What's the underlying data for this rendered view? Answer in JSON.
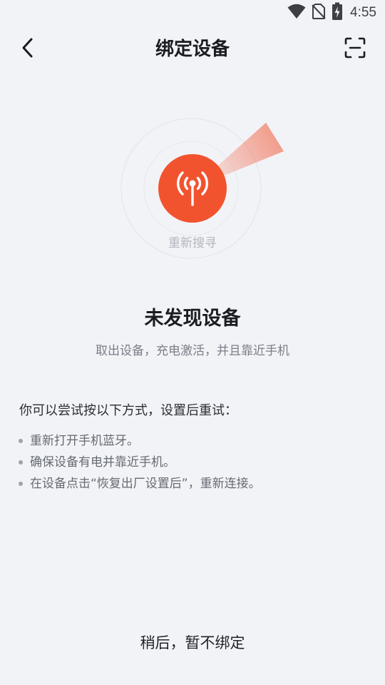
{
  "status_bar": {
    "time": "4:55",
    "icons": [
      "wifi-icon",
      "no-sim-icon",
      "battery-charging-icon"
    ]
  },
  "header": {
    "title": "绑定设备",
    "back_icon": "chevron-left-icon",
    "scan_icon": "scan-icon"
  },
  "radar": {
    "center_icon": "signal-tower-icon",
    "accent_color": "#f2532f",
    "rescan_label": "重新搜寻"
  },
  "result": {
    "title": "未发现设备",
    "subtitle": "取出设备，充电激活，并且靠近手机"
  },
  "tips": {
    "heading": "你可以尝试按以下方式，设置后重试：",
    "items": [
      "重新打开手机蓝牙。",
      "确保设备有电并靠近手机。",
      "在设备点击“恢复出厂设置后”，重新连接。"
    ]
  },
  "footer": {
    "skip_label": "稍后，暂不绑定"
  }
}
